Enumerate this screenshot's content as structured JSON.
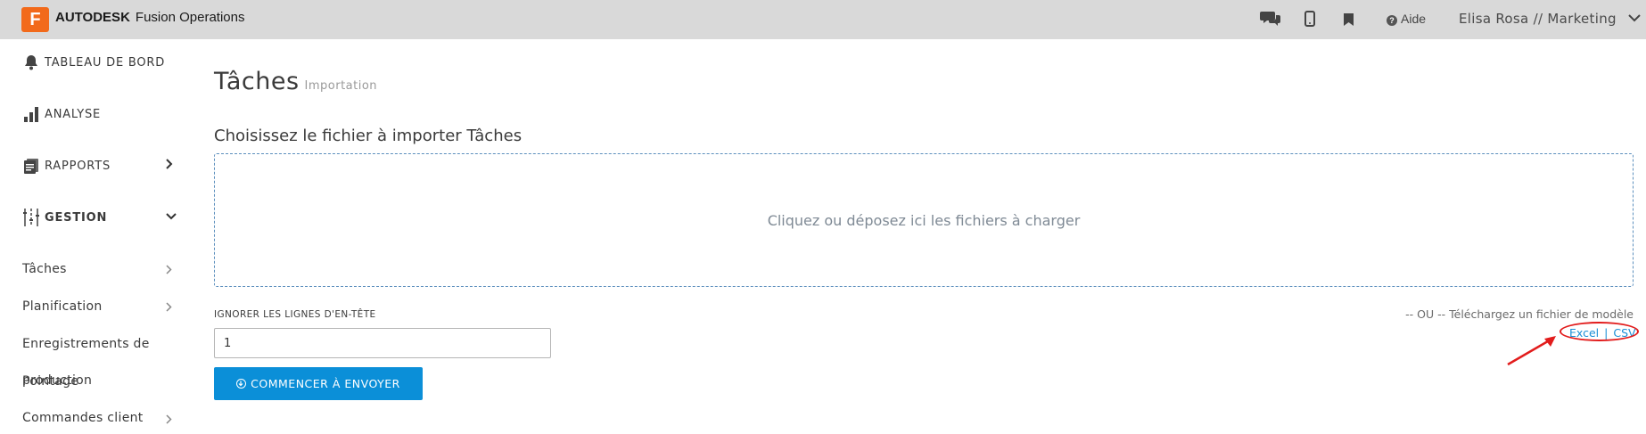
{
  "header": {
    "logo_letter": "F",
    "brand_bold": "AUTODESK",
    "brand_rest": "Fusion Operations",
    "help_label": "Aide",
    "user_label": "Elisa Rosa // Marketing",
    "icons": [
      "chat-icon",
      "mobile-icon",
      "bookmark-icon",
      "help-icon",
      "chevron-down-icon"
    ]
  },
  "sidebar": {
    "items": [
      {
        "label": "TABLEAU DE BORD",
        "icon": "bell-icon"
      },
      {
        "label": "ANALYSE",
        "icon": "bar-chart-icon"
      },
      {
        "label": "RAPPORTS",
        "icon": "report-icon"
      },
      {
        "label": "GESTION",
        "icon": "sliders-icon"
      }
    ],
    "subitems": [
      {
        "label": "Tâches"
      },
      {
        "label": "Planification"
      },
      {
        "label": "Enregistrements de"
      },
      {
        "label": "production"
      },
      {
        "label": "Pointage"
      },
      {
        "label": "Commandes client"
      }
    ]
  },
  "main": {
    "title": "Tâches",
    "subtitle": "Importation",
    "section_title": "Choisissez le fichier à importer Tâches",
    "dropzone_text": "Cliquez ou déposez ici les fichiers à charger",
    "header_lines_label": "IGNORER LES LIGNES D'EN-TÊTE",
    "header_lines_value": "1",
    "start_button": "COMMENCER À ENVOYER",
    "template_text": "-- OU -- Téléchargez un fichier de modèle",
    "template_excel": "Excel",
    "template_separator": "|",
    "template_csv": "CSV"
  },
  "colors": {
    "topbar": "#d9d9d9",
    "brand_orange": "#f26a1b",
    "primary_button": "#0b8fd8",
    "link": "#1a8fd6",
    "dropzone_border": "#5c8fbd",
    "annotation_red": "#e21c1c"
  }
}
